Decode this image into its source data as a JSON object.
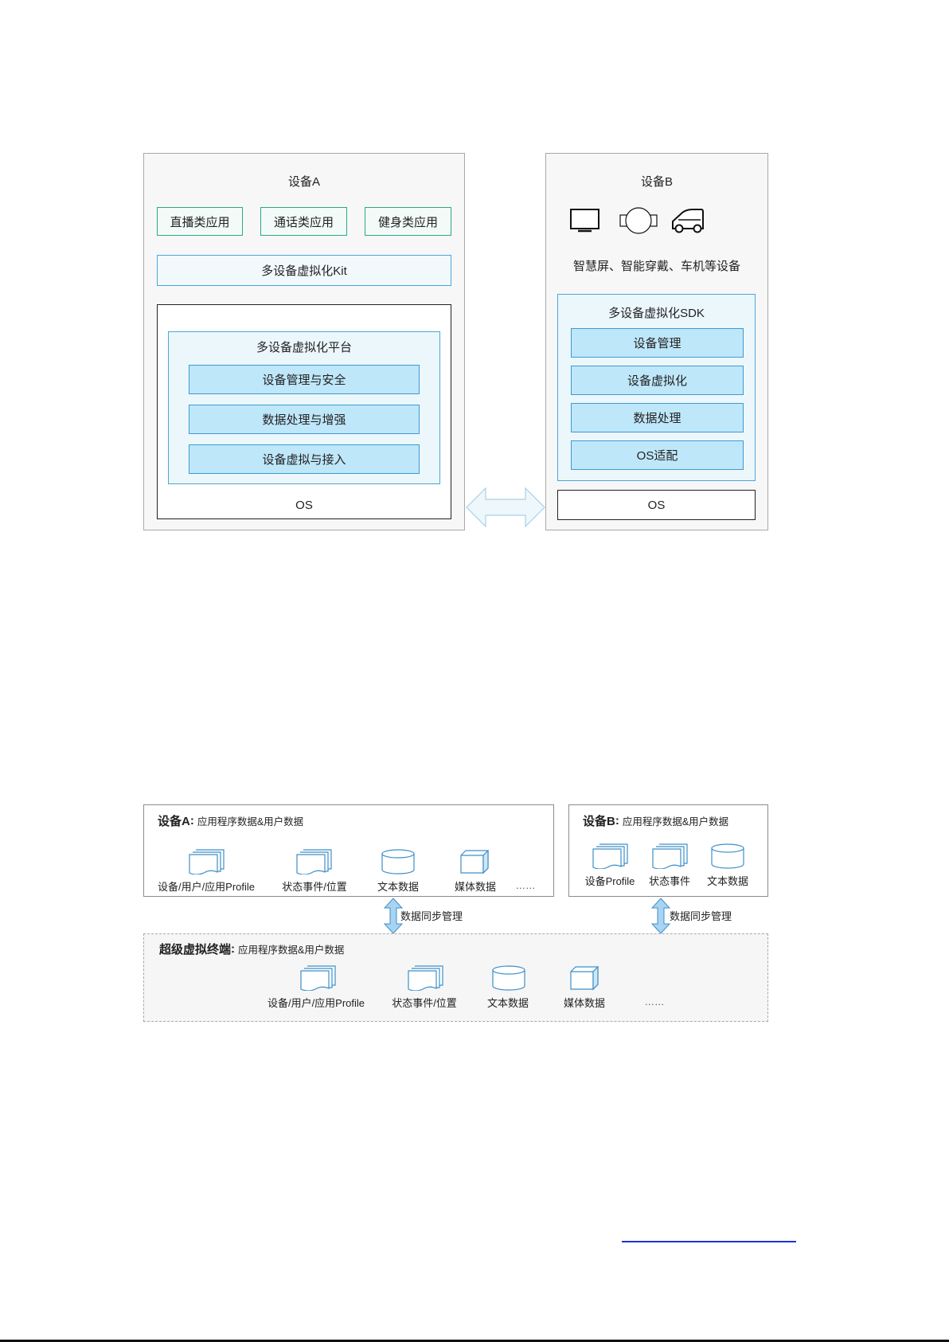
{
  "diagram1": {
    "device_a": {
      "title": "设备A",
      "apps": [
        "直播类应用",
        "通话类应用",
        "健身类应用"
      ],
      "kit": "多设备虚拟化Kit",
      "platform_title": "多设备虚拟化平台",
      "modules": [
        "设备管理与安全",
        "数据处理与增强",
        "设备虚拟与接入"
      ],
      "os": "OS"
    },
    "device_b": {
      "title": "设备B",
      "icons": [
        "tv-icon",
        "wearable-icon",
        "car-icon"
      ],
      "caption": "智慧屏、智能穿戴、车机等设备",
      "sdk_title": "多设备虚拟化SDK",
      "modules": [
        "设备管理",
        "设备虚拟化",
        "数据处理",
        "OS适配"
      ],
      "os": "OS"
    }
  },
  "diagram2": {
    "device_a": {
      "title": "设备A",
      "subtitle": "应用程序数据&用户数据",
      "items": [
        {
          "label": "设备/用户/应用Profile",
          "icon": "document-stack-icon"
        },
        {
          "label": "状态事件/位置",
          "icon": "document-stack-icon"
        },
        {
          "label": "文本数据",
          "icon": "database-cylinder-icon"
        },
        {
          "label": "媒体数据",
          "icon": "cube-icon"
        }
      ],
      "ellipsis": "……"
    },
    "device_b": {
      "title": "设备B",
      "subtitle": "应用程序数据&用户数据",
      "items": [
        {
          "label": "设备Profile",
          "icon": "document-stack-icon"
        },
        {
          "label": "状态事件",
          "icon": "document-stack-icon"
        },
        {
          "label": "文本数据",
          "icon": "database-cylinder-icon"
        }
      ]
    },
    "sync_label": "数据同步管理",
    "super_terminal": {
      "title": "超级虚拟终端",
      "subtitle": "应用程序数据&用户数据",
      "items": [
        {
          "label": "设备/用户/应用Profile",
          "icon": "document-stack-icon"
        },
        {
          "label": "状态事件/位置",
          "icon": "document-stack-icon"
        },
        {
          "label": "文本数据",
          "icon": "database-cylinder-icon"
        },
        {
          "label": "媒体数据",
          "icon": "cube-icon"
        }
      ],
      "ellipsis": "……"
    }
  },
  "colors": {
    "module_fill": "#bfe7fa",
    "module_border": "#3d9bd0",
    "app_border": "#2ea58a",
    "icon_stroke": "#3d8fc8",
    "sync_arrow_fill": "#a9d3f2",
    "link": "#1a33d8"
  }
}
